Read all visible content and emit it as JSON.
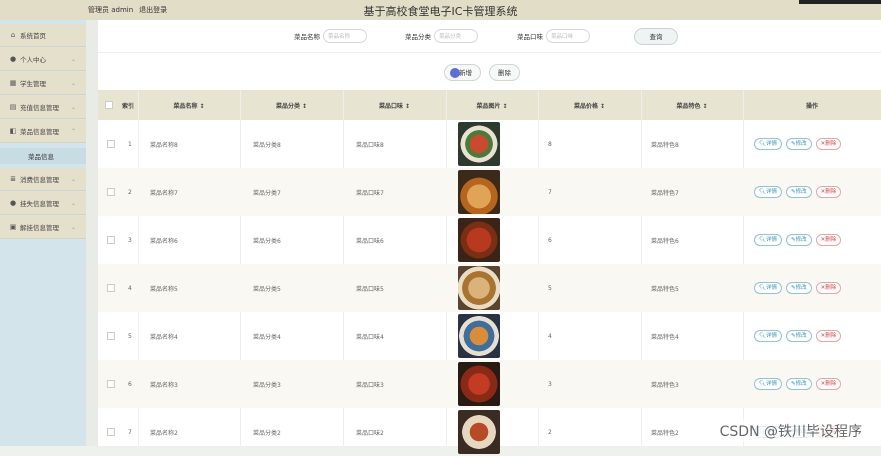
{
  "header": {
    "user_label": "管理员 admin",
    "logout_label": "退出登录",
    "title": "基于高校食堂电子IC卡管理系统"
  },
  "sidebar": {
    "items": [
      {
        "label": "系统首页",
        "icon": "home-icon"
      },
      {
        "label": "个人中心",
        "icon": "user-icon"
      },
      {
        "label": "学生管理",
        "icon": "grid-icon"
      },
      {
        "label": "充值信息管理",
        "icon": "card-icon"
      },
      {
        "label": "菜品信息管理",
        "icon": "dish-icon"
      },
      {
        "label": "消费信息管理",
        "icon": "list-icon"
      },
      {
        "label": "挂失信息管理",
        "icon": "user-icon"
      },
      {
        "label": "解挂信息管理",
        "icon": "unlock-icon"
      }
    ],
    "active_sub": "菜品信息"
  },
  "search": {
    "fields": [
      {
        "label": "菜品名称",
        "placeholder": "菜品名称"
      },
      {
        "label": "菜品分类",
        "placeholder": "菜品分类"
      },
      {
        "label": "菜品口味",
        "placeholder": "菜品口味"
      }
    ],
    "query_label": "查询"
  },
  "actions": {
    "add_label": "新增",
    "delete_label": "删除"
  },
  "table": {
    "headers": [
      "索引",
      "菜品名称 ↕",
      "菜品分类 ↕",
      "菜品口味 ↕",
      "菜品图片 ↕",
      "菜品价格 ↕",
      "菜品特色 ↕",
      "操作"
    ],
    "op_labels": {
      "detail": "详情",
      "edit": "修改",
      "delete": "删除"
    },
    "rows": [
      {
        "index": "1",
        "name": "菜品名称8",
        "category": "菜品分类8",
        "taste": "菜品口味8",
        "price": "8",
        "feature": "菜品特色8"
      },
      {
        "index": "2",
        "name": "菜品名称7",
        "category": "菜品分类7",
        "taste": "菜品口味7",
        "price": "7",
        "feature": "菜品特色7"
      },
      {
        "index": "3",
        "name": "菜品名称6",
        "category": "菜品分类6",
        "taste": "菜品口味6",
        "price": "6",
        "feature": "菜品特色6"
      },
      {
        "index": "4",
        "name": "菜品名称5",
        "category": "菜品分类5",
        "taste": "菜品口味5",
        "price": "5",
        "feature": "菜品特色5"
      },
      {
        "index": "5",
        "name": "菜品名称4",
        "category": "菜品分类4",
        "taste": "菜品口味4",
        "price": "4",
        "feature": "菜品特色4"
      },
      {
        "index": "6",
        "name": "菜品名称3",
        "category": "菜品分类3",
        "taste": "菜品口味3",
        "price": "3",
        "feature": "菜品特色3"
      },
      {
        "index": "7",
        "name": "菜品名称2",
        "category": "菜品分类2",
        "taste": "菜品口味2",
        "price": "2",
        "feature": "菜品特色2"
      }
    ]
  },
  "watermark": "CSDN @铁川毕设程序",
  "colors": {
    "header_bg": "#e2ddc6",
    "sidebar_bg": "#d3e5ea",
    "accent": "#3a8fb7",
    "danger": "#d64545"
  }
}
